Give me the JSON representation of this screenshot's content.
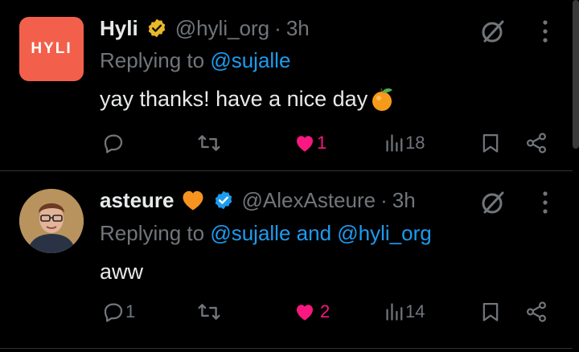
{
  "tweets": [
    {
      "name": "Hyli",
      "handle": "@hyli_org",
      "separator": "·",
      "time": "3h",
      "avatar_text": "HYLI",
      "replying_prefix": "Replying to",
      "replying_to": "@sujalle",
      "replying_and": "",
      "replying_to_2": "",
      "text": "yay thanks! have a nice day",
      "text_emoji": "tangerine-emoji",
      "replies": "",
      "retweets": "",
      "likes": "1",
      "views": "18",
      "liked": true
    },
    {
      "name": "asteure",
      "name_emoji": "orange-heart-emoji",
      "handle": "@AlexAsteure",
      "separator": "·",
      "time": "3h",
      "replying_prefix": "Replying to",
      "replying_to": "@sujalle",
      "replying_and": "and",
      "replying_to_2": "@hyli_org",
      "text": "aww",
      "replies": "1",
      "retweets": "",
      "likes": "2",
      "views": "14",
      "liked": true
    }
  ],
  "colors": {
    "background": "#000000",
    "text": "#e7e9ea",
    "muted": "#71767b",
    "link": "#1d9bf0",
    "like": "#f91880",
    "gold_badge": "#e8b829",
    "blue_badge": "#1d9bf0",
    "hyli_brand": "#f2604b"
  }
}
